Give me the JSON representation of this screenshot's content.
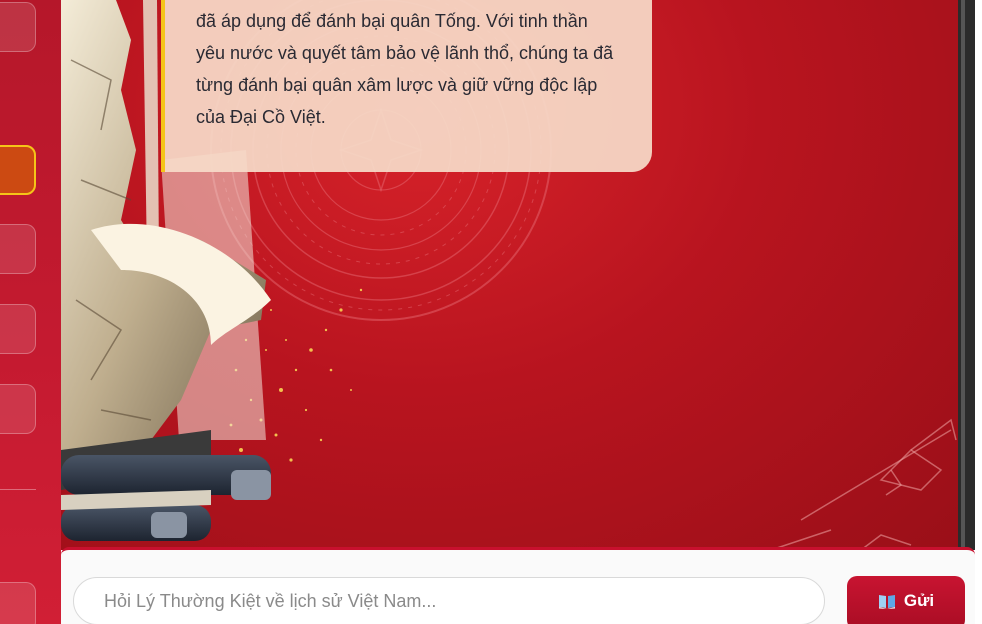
{
  "chat": {
    "message_lines": [
      "đã áp dụng để đánh bại quân Tống. Với tinh thần",
      "yêu nước và quyết tâm bảo vệ lãnh thổ, chúng ta đã",
      "từng đánh bại quân xâm lược và giữ vững độc lập",
      "của Đại Cồ Việt."
    ]
  },
  "input": {
    "placeholder": "Hỏi Lý Thường Kiệt về lịch sử Việt Nam...",
    "value": ""
  },
  "send_button": {
    "label": "Gửi",
    "icon": "book-icon"
  },
  "sidebar": {
    "active_index": 1,
    "button_count": 6
  },
  "colors": {
    "primary_red": "#c8102e",
    "accent_gold": "#f5c518",
    "active_orange": "#cc4a12",
    "bubble_bg": "#f6dac8"
  }
}
